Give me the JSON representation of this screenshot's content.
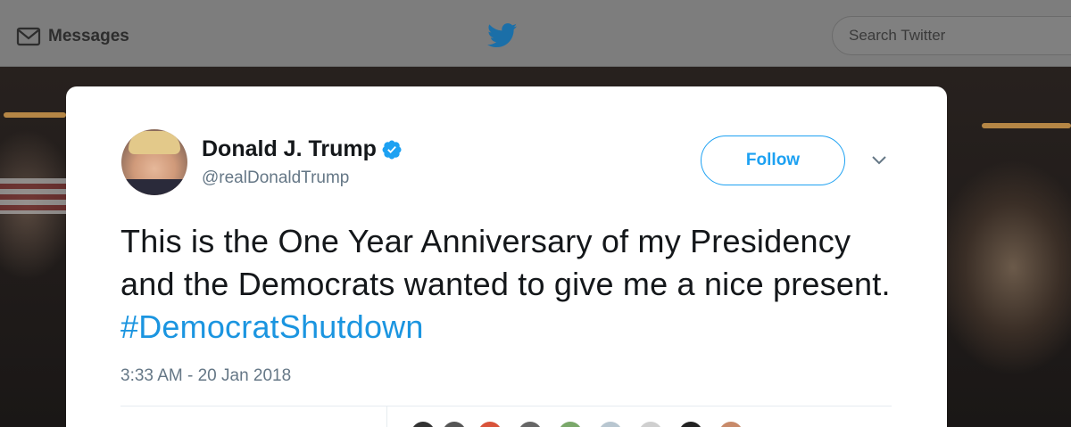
{
  "header": {
    "messages_label": "Messages",
    "search_placeholder": "Search Twitter"
  },
  "tweet": {
    "author_name": "Donald J. Trump",
    "author_handle": "@realDonaldTrump",
    "follow_label": "Follow",
    "text_main": "This is the One Year Anniversary of my Presidency and the Democrats wanted to give me a nice present. ",
    "hashtag": "#DemocratShutdown",
    "timestamp": "3:33 AM - 20 Jan 2018"
  },
  "colors": {
    "accent": "#1da1f2",
    "hashtag": "#1b95e0",
    "secondary_text": "#657786",
    "primary_text": "#14171a",
    "topbar": "#7d7d7d"
  },
  "icons": {
    "messages": "envelope-icon",
    "logo": "twitter-bird-icon",
    "verified": "verified-badge-icon",
    "menu": "chevron-down-icon"
  }
}
